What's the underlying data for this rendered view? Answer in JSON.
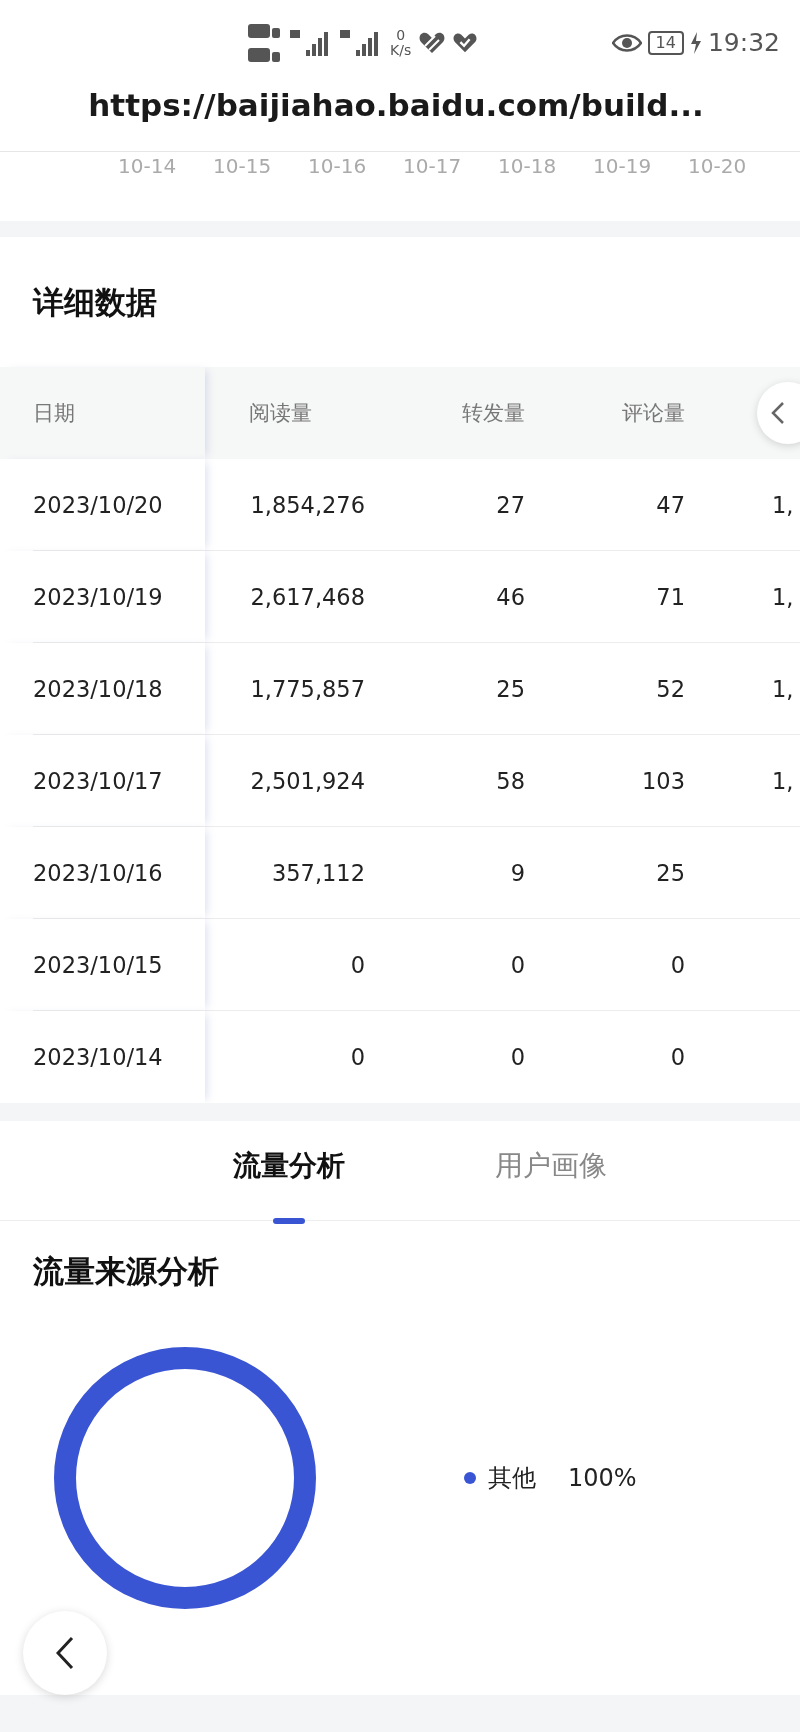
{
  "status_bar": {
    "network_speed_value": "0",
    "network_speed_unit": "K/s",
    "battery": "14",
    "time": "19:32"
  },
  "url_bar": {
    "url": "https://baijiahao.baidu.com/build..."
  },
  "trend_axis_labels": [
    "10-14",
    "10-15",
    "10-16",
    "10-17",
    "10-18",
    "10-19",
    "10-20"
  ],
  "detail_section": {
    "title": "详细数据",
    "table": {
      "columns": [
        "日期",
        "阅读量",
        "转发量",
        "评论量"
      ],
      "rows": [
        {
          "date": "2023/10/20",
          "reads": "1,854,276",
          "shares": "27",
          "comments": "47",
          "column_5": "1,"
        },
        {
          "date": "2023/10/19",
          "reads": "2,617,468",
          "shares": "46",
          "comments": "71",
          "column_5": "1,"
        },
        {
          "date": "2023/10/18",
          "reads": "1,775,857",
          "shares": "25",
          "comments": "52",
          "column_5": "1,"
        },
        {
          "date": "2023/10/17",
          "reads": "2,501,924",
          "shares": "58",
          "comments": "103",
          "column_5": "1,"
        },
        {
          "date": "2023/10/16",
          "reads": "357,112",
          "shares": "9",
          "comments": "25"
        },
        {
          "date": "2023/10/15",
          "reads": "0",
          "shares": "0",
          "comments": "0"
        },
        {
          "date": "2023/10/14",
          "reads": "0",
          "shares": "0",
          "comments": "0"
        }
      ]
    }
  },
  "tabs": [
    {
      "label": "流量分析",
      "selected": true
    },
    {
      "label": "用户画像",
      "selected": false
    }
  ],
  "traffic_source": {
    "title": "流量来源分析",
    "legend": [
      {
        "label": "其他",
        "value": "100%",
        "color": "#3a55d3"
      }
    ]
  }
}
